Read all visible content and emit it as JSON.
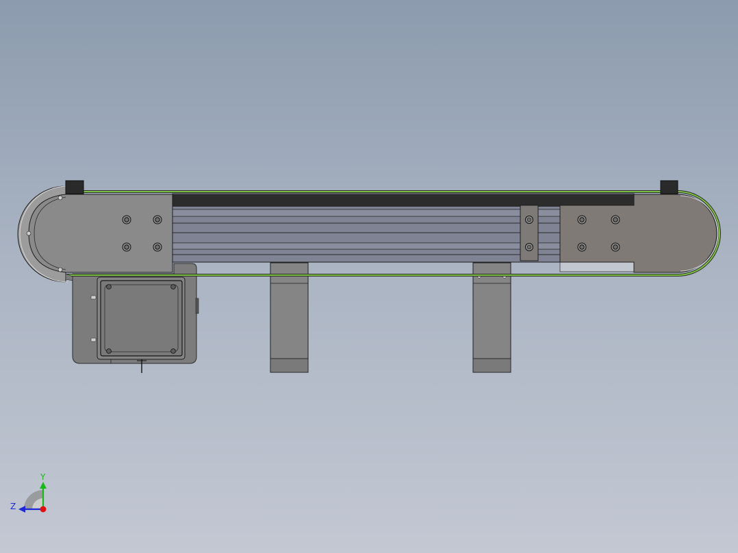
{
  "triad": {
    "y_label": "Y",
    "z_label": "Z"
  },
  "colors": {
    "background_top": "#8c9bae",
    "background_bottom": "#c3c8d3",
    "belt": "#7fc241",
    "plate_left": "#8a8a8a",
    "plate_right": "#807a76",
    "rail_body": "#808394",
    "top_strip": "#2c2c2c",
    "axis_y": "#18b818",
    "axis_z": "#1c28d8",
    "axis_x": "#e01010"
  }
}
